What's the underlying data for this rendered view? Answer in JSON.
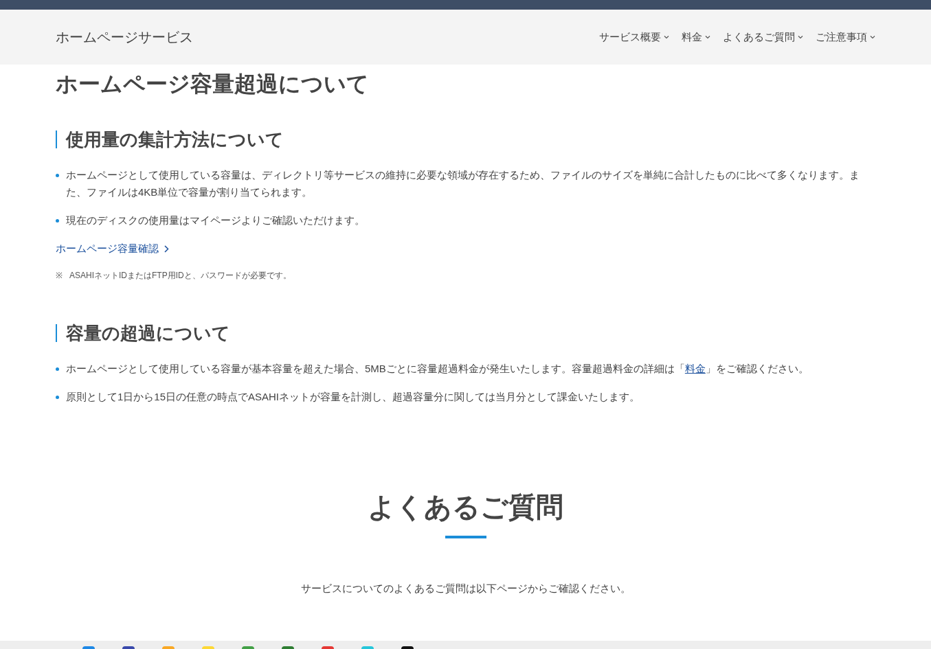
{
  "header": {
    "site_title": "ホームページサービス",
    "nav": [
      {
        "label": "サービス概要"
      },
      {
        "label": "料金"
      },
      {
        "label": "よくあるご質問"
      },
      {
        "label": "ご注意事項"
      }
    ]
  },
  "page_title": "ホームページ容量超過について",
  "sections": [
    {
      "heading": "使用量の集計方法について",
      "bullets": [
        {
          "text": "ホームページとして使用している容量は、ディレクトリ等サービスの維持に必要な領域が存在するため、ファイルのサイズを単純に合計したものに比べて多くなります。また、ファイルは4KB単位で容量が割り当てられます。"
        },
        {
          "text": "現在のディスクの使用量はマイページよりご確認いただけます。"
        }
      ],
      "link": "ホームページ容量確認",
      "note_mark": "※",
      "note": "ASAHIネットIDまたはFTP用IDと、パスワードが必要です。"
    },
    {
      "heading": "容量の超過について",
      "bullets": [
        {
          "text": "ホームページとして使用している容量が基本容量を超えた場合、5MBごとに容量超過料金が発生いたします。容量超過料金の詳細は「",
          "link": "料金",
          "text_after": "」をご確認ください。"
        },
        {
          "text": "原則として1日から15日の任意の時点でASAHIネットが容量を計測し、超過容量分に関しては当月分として課金いたします。"
        }
      ]
    }
  ],
  "faq": {
    "heading": "よくあるご質問",
    "text": "サービスについてのよくあるご質問は以下ページからご確認ください。"
  }
}
